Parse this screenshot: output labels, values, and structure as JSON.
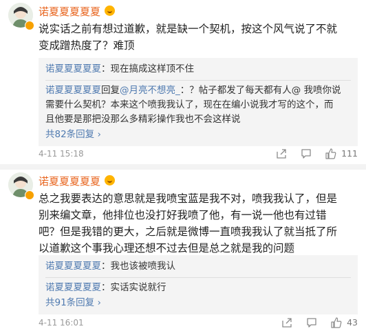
{
  "comments": [
    {
      "username": "诺夏夏夏夏夏",
      "lines": [
        "说实话之前有想过道歉，就是缺一个契机，按这个风气说了不就",
        "变成蹭热度了？难顶"
      ],
      "replies": [
        {
          "name": "诺夏夏夏夏夏",
          "text": "：现在搞成这样顶不住"
        },
        {
          "name": "诺夏夏夏夏夏",
          "reply_word": "回复",
          "at": "@月亮不想亮_",
          "lines": [
            "：？帖子都发了每天都有人@ 我喷你说",
            "需要什么契机？本来这个喷我我认了，现在在编小说我才写的这个，而",
            "且他要是那把没那么多精彩操作我也不会这样说"
          ]
        }
      ],
      "more": "共82条回复",
      "time": "4-11 15:18",
      "likes": "111"
    },
    {
      "username": "诺夏夏夏夏夏",
      "lines": [
        "总之我要表达的意思就是我喷宝蓝是我不对，喷我我认了，但是",
        "别来编文章，他排位也没打好我喷了他，有一说一他也有过错",
        "吧？但是我错的更大，之后就是微博一直喷我我认了就当抵了所",
        "以道歉这个事我心理还想不过去但是总之就是我的问题"
      ],
      "replies": [
        {
          "name": "诺夏夏夏夏夏",
          "text": "：我也该被喷我认"
        },
        {
          "name": "诺夏夏夏夏夏",
          "text": "：实话实说就行"
        }
      ],
      "more": "共91条回复",
      "time": "4-11 16:01",
      "likes": "43"
    }
  ],
  "icons": {
    "chevron": "›",
    "share": "share-icon",
    "comment": "comment-icon",
    "like": "like-icon"
  },
  "colors": {
    "username": "#e8651f",
    "reply_name": "#4f7ab0",
    "reply_bg": "#f4f4f4",
    "verified_badge": "#f7a100"
  }
}
